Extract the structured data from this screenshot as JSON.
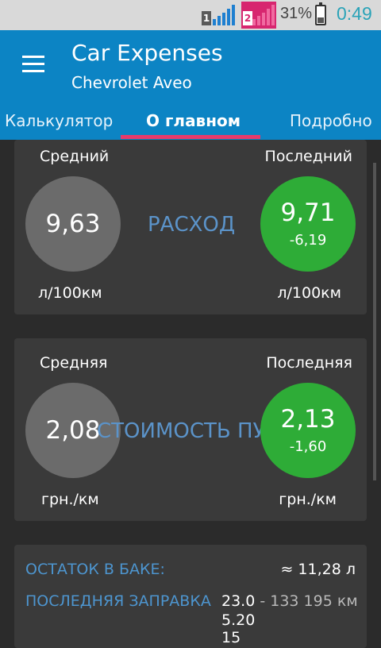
{
  "status": {
    "sim1": "1",
    "sim2": "2",
    "battery": "31%",
    "time": "0:49",
    "colors": {
      "sim2_bg": "#d7266f",
      "signal": "#1e7fd0",
      "clock": "#2aa3b8"
    }
  },
  "appbar": {
    "title": "Car Expenses",
    "subtitle": "Chevrolet Aveo",
    "menu_icon": "hamburger-menu-icon"
  },
  "tabs": [
    {
      "label": "Калькулятор",
      "active": false
    },
    {
      "label": "О главном",
      "active": true
    },
    {
      "label": "Подробно",
      "active": false
    }
  ],
  "consumption": {
    "left_label": "Средний",
    "right_label": "Последний",
    "center_label": "РАСХОД",
    "avg_value": "9,63",
    "last_value": "9,71",
    "last_delta": "-6,19",
    "left_unit": "л/100км",
    "right_unit": "л/100км"
  },
  "trip_cost": {
    "left_label": "Средняя",
    "right_label": "Последняя",
    "center_label": "СТОИМОСТЬ ПУТИ",
    "avg_value": "2,08",
    "last_value": "2,13",
    "last_delta": "-1,60",
    "left_unit": "грн./км",
    "right_unit": "грн./км"
  },
  "info": {
    "tank_label": "ОСТАТОК В БАКЕ:",
    "tank_value": "≈ 11,28 л",
    "refuel_label": "ПОСЛЕДНЯЯ ЗАПРАВКА",
    "refuel_date": "23.0",
    "refuel_odometer": " - 133 195 км",
    "refuel_line2": "5.20",
    "refuel_line3": "15"
  },
  "colors": {
    "appbar": "#0c84c4",
    "accent": "#e83a6b",
    "card_bg": "#3a3a3a",
    "grey_circle": "#6b6b6b",
    "green_circle": "#2eac37",
    "label_blue": "#5b93c9"
  }
}
